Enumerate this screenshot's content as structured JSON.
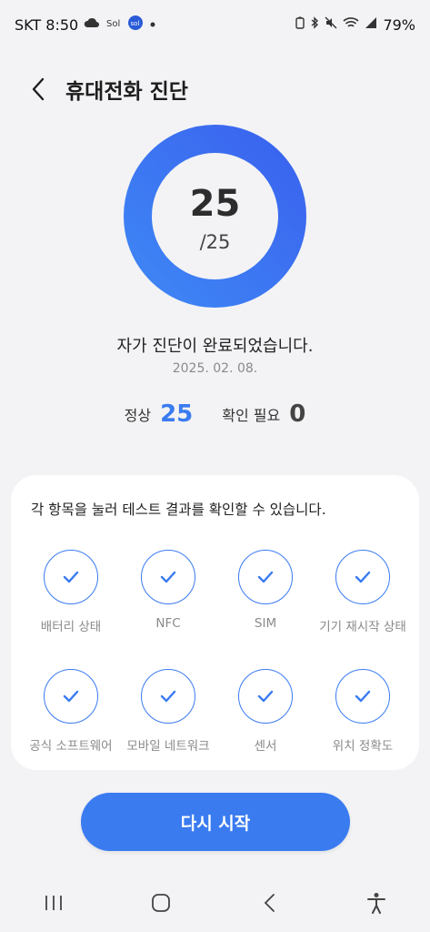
{
  "status_bar": {
    "carrier_time": "SKT 8:50",
    "battery": "79%",
    "left_icons": [
      "cloud-icon",
      "sol-bank-icon",
      "sol-app-icon",
      "dot-icon"
    ],
    "right_icons": [
      "battery-saver-icon",
      "bluetooth-icon",
      "mute-icon",
      "wifi-icon",
      "signal-icon"
    ]
  },
  "header": {
    "title": "휴대전화 진단"
  },
  "result": {
    "score": "25",
    "total": "/25",
    "progress": 1.0,
    "message": "자가 진단이 완료되었습니다.",
    "date": "2025. 02. 08."
  },
  "summary": {
    "normal_label": "정상",
    "normal_value": "25",
    "check_label": "확인 필요",
    "check_value": "0"
  },
  "card": {
    "hint": "각 항목을 눌러 테스트 결과를 확인할 수 있습니다.",
    "items": [
      {
        "label": "배터리 상태",
        "status": "pass"
      },
      {
        "label": "NFC",
        "status": "pass"
      },
      {
        "label": "SIM",
        "status": "pass"
      },
      {
        "label": "기기 재시작 상태",
        "status": "pass"
      },
      {
        "label": "공식 소프트웨어",
        "status": "pass"
      },
      {
        "label": "모바일 네트워크",
        "status": "pass"
      },
      {
        "label": "센서",
        "status": "pass"
      },
      {
        "label": "위치 정확도",
        "status": "pass"
      }
    ]
  },
  "restart_label": "다시 시작",
  "colors": {
    "accent": "#3a7bf0",
    "background": "#f3f3f5"
  }
}
